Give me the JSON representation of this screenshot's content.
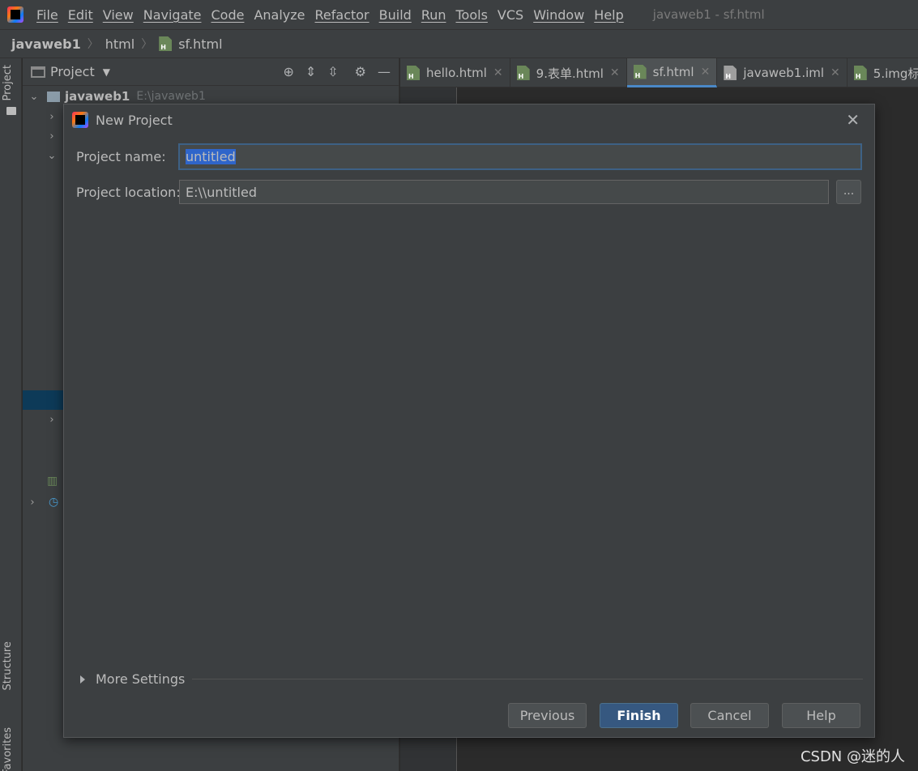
{
  "menubar": {
    "items": [
      "File",
      "Edit",
      "View",
      "Navigate",
      "Code",
      "Analyze",
      "Refactor",
      "Build",
      "Run",
      "Tools",
      "VCS",
      "Window",
      "Help"
    ],
    "window_title": "javaweb1 - sf.html"
  },
  "breadcrumb": {
    "project": "javaweb1",
    "folder": "html",
    "file": "sf.html"
  },
  "left_strip": {
    "project_tab": "Project",
    "structure_tab": "Structure",
    "favorites_tab": "Favorites"
  },
  "project_panel": {
    "title": "Project",
    "root_name": "javaweb1",
    "root_path": "E:\\javaweb1"
  },
  "editor_tabs": [
    {
      "label": "hello.html",
      "icon": "html-file-icon"
    },
    {
      "label": "9.表单.html",
      "icon": "html-file-icon"
    },
    {
      "label": "sf.html",
      "icon": "html-file-icon"
    },
    {
      "label": "javaweb1.iml",
      "icon": "iml-file-icon"
    },
    {
      "label": "5.img标",
      "icon": "html-file-icon"
    }
  ],
  "dialog": {
    "title": "New Project",
    "name_label": "Project name:",
    "name_value": "untitled",
    "location_label": "Project location:",
    "location_value": "E:\\\\untitled",
    "browse_label": "...",
    "more_settings": "More Settings",
    "buttons": {
      "previous": "Previous",
      "finish": "Finish",
      "cancel": "Cancel",
      "help": "Help"
    }
  },
  "watermark": "CSDN @迷的人",
  "colors": {
    "accent": "#365880",
    "selection": "#2f65ca",
    "background": "#3c3f41"
  }
}
